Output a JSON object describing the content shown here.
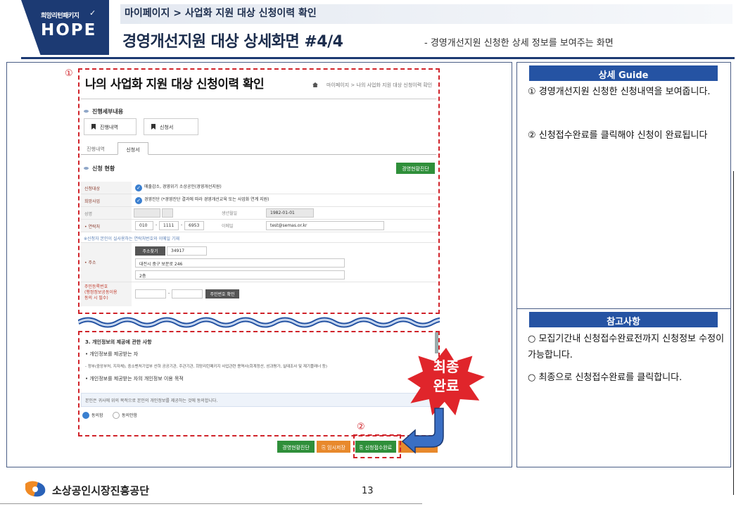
{
  "header": {
    "logo_small": "희망리턴패키지",
    "logo_big": "HOPE",
    "breadcrumb": "마이페이지 > 사업화 지원 대상 신청이력 확인",
    "title": "경영개선지원 대상 상세화면 #4/4",
    "subtitle": "- 경영개선지원 신청한 상세 정보를 보여주는 화면"
  },
  "markers": {
    "one": "①",
    "two": "②"
  },
  "screen": {
    "title": "나의 사업화 지원 대상 신청이력 확인",
    "breadcrumb": "마이페이지  >  나의 사업화 지원 대상 신청이력 확인",
    "section1": "진행세부내용",
    "btn_progress": "진행내역",
    "btn_application": "신청서",
    "tab1": "진행내역",
    "tab2": "신청서",
    "section2": "신청 현황",
    "diagnosis_btn": "경영현황진단",
    "form": {
      "target_label": "신청대상",
      "target_value": "매출감소, 경영위기 소상공인(경영개선지원)",
      "project_label": "희망사업",
      "project_value": "경영진단  (*경영진단 결과에 따라 경영개선교육 또는 사업화 연계 지원)",
      "name_label": "성명",
      "birth_label": "생년월일",
      "birth_value": "1982-01-01",
      "phone_label": "• 연락처",
      "phone1": "010",
      "phone2": "1111",
      "phone3": "6953",
      "email_label": "이메일",
      "email_value": "test@semas.or.kr",
      "notice": "※신청자 본인이 실사용하는 연락처번호와 이메일 기재",
      "zip_btn": "주소찾기",
      "zip_value": "34917",
      "address_label": "• 주소",
      "address1": "대전시 중구 보문로 246",
      "address2": "2층",
      "rrn_label": "주민등록번호\n(행정정보공동이용\n동의 시 필수)",
      "rrn_btn": "주민번호 확인"
    }
  },
  "section3": {
    "title": "3. 개인정보의 제공에 관한 사항",
    "item1": "• 개인정보를 제공받는 자",
    "item1_detail": "-     정부(중앙부처, 지자체), 중소벤처기업부 산하 공공기관, 주관기관, 희망리턴패키지 사업관련 용역사(회계정산, 성과평가, 실태조사 및 재기플래너 등)",
    "item2": "• 개인정보를 제공받는 자의 개인정보 이용 목적",
    "notice": "본인은 귀사에 위의 목적으로 본인의 개인정보를 제공하는 것에 동의합니다.",
    "agree": "동의함",
    "disagree": "동의안함"
  },
  "bottom_buttons": {
    "diagnosis": "경영현황진단",
    "temp_save": "임시저장",
    "submit": "신청접수완료"
  },
  "callout": {
    "line1": "최종",
    "line2": "완료"
  },
  "guide": {
    "title": "상세 Guide",
    "text1": "① 경영개선지원 신청한 신청내역을 보여줍니다.",
    "text2": "② 신청접수완료를 클릭해야 신청이 완료됩니다"
  },
  "reference": {
    "title": "참고사항",
    "text1": "○ 모집기간내 신청접수완료전까지 신청정보 수정이 가능합니다.",
    "text2": "○ 최종으로 신청접수완료를 클릭합니다."
  },
  "footer": {
    "org": "소상공인시장진흥공단",
    "page": "13"
  },
  "colors": {
    "navy": "#1c3a73",
    "accent_red": "#d0232a",
    "guide_blue": "#2553a3",
    "green": "#2f8f3a",
    "orange": "#e8892c"
  }
}
